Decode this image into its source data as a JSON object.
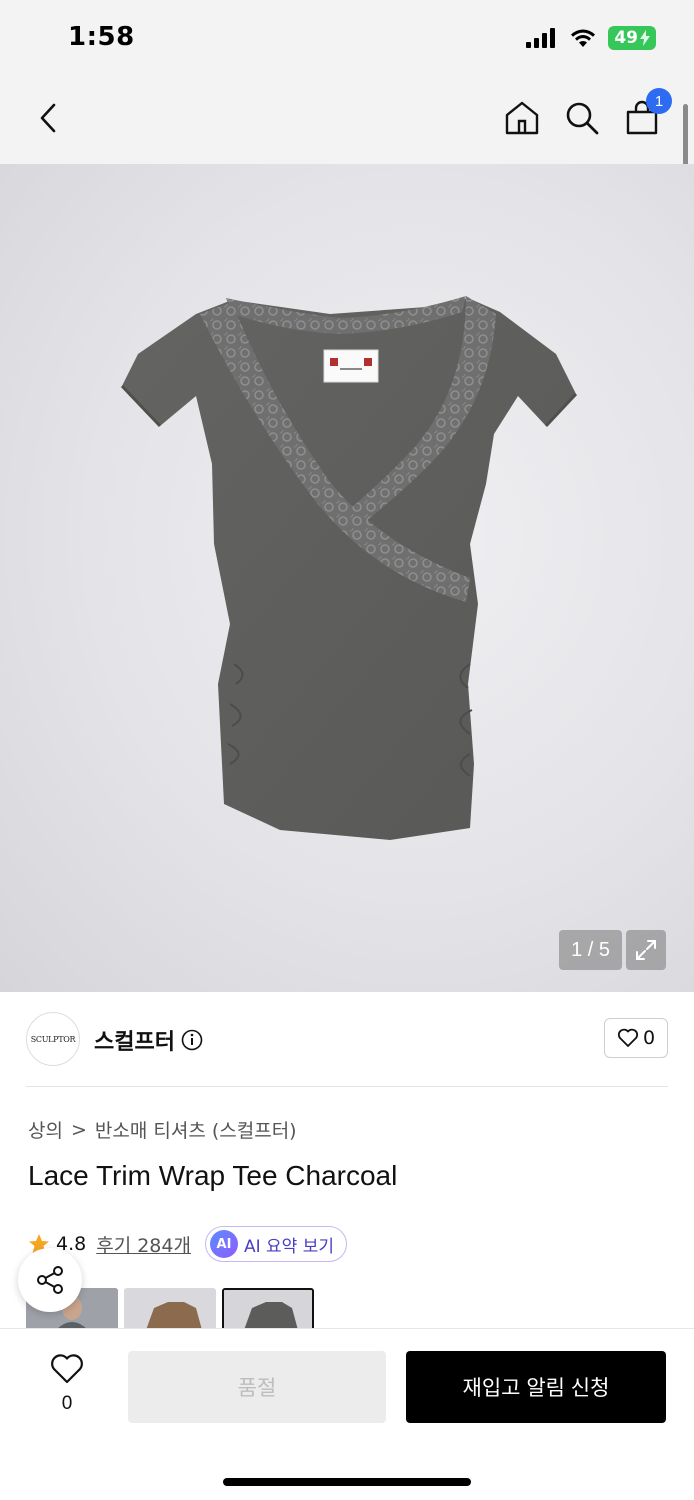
{
  "status_bar": {
    "time": "1:58",
    "battery": "49"
  },
  "header": {
    "cart_count": "1"
  },
  "gallery": {
    "counter": "1 / 5"
  },
  "brand": {
    "logo_text": "SCULPTOR",
    "name": "스컬프터",
    "like_count": "0"
  },
  "breadcrumb": {
    "category": "상의",
    "separator": ">",
    "subcategory": "반소매 티셔츠 (스컬프터)"
  },
  "product": {
    "title": "Lace Trim Wrap Tee Charcoal"
  },
  "rating": {
    "score": "4.8",
    "reviews": "후기 284개",
    "ai_badge": "AI",
    "ai_summary": "AI 요약 보기"
  },
  "bottom": {
    "wish_count": "0",
    "soldout_label": "품절",
    "restock_label": "재입고 알림 신청"
  },
  "colors": {
    "accent_blue": "#2c6bf2",
    "battery_green": "#35c759",
    "star": "#f5a623",
    "ai_purple": "#4a3dc6"
  }
}
